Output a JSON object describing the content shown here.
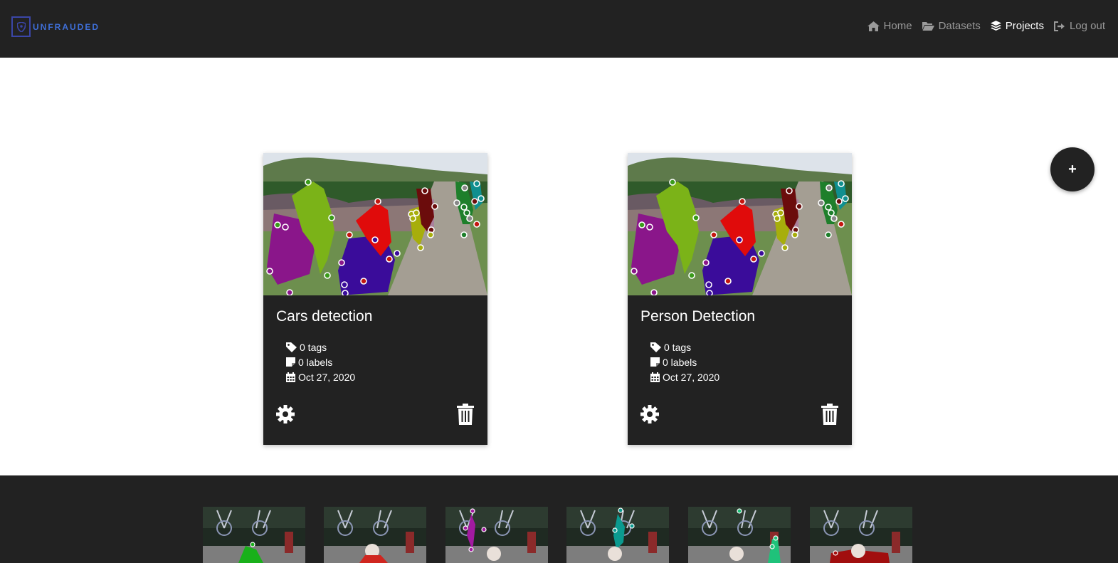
{
  "brand": {
    "name": "UNFRAUDED",
    "icon": "shield-logo-icon",
    "color": "#3f6fd8"
  },
  "nav": {
    "items": [
      {
        "label": "Home",
        "icon": "home-icon",
        "active": false
      },
      {
        "label": "Datasets",
        "icon": "folder-open-icon",
        "active": false
      },
      {
        "label": "Projects",
        "icon": "layers-icon",
        "active": true
      },
      {
        "label": "Log out",
        "icon": "logout-icon",
        "active": false
      }
    ]
  },
  "add_button": {
    "label": "+",
    "icon": "plus-icon"
  },
  "projects": [
    {
      "title": "Cars detection",
      "tags": "0 tags",
      "labels": "0 labels",
      "date": "Oct 27, 2020",
      "thumbnail_icon": "segmented-cyclists-image"
    },
    {
      "title": "Person Detection",
      "tags": "0 tags",
      "labels": "0 labels",
      "date": "Oct 27, 2020",
      "thumbnail_icon": "segmented-cyclists-image"
    }
  ],
  "footer": {
    "thumbnails": [
      "green",
      "red",
      "purple",
      "teal",
      "mint",
      "darkred"
    ]
  },
  "colors": {
    "dark": "#222222",
    "inactive_nav": "#9a9a9a",
    "white": "#ffffff"
  }
}
